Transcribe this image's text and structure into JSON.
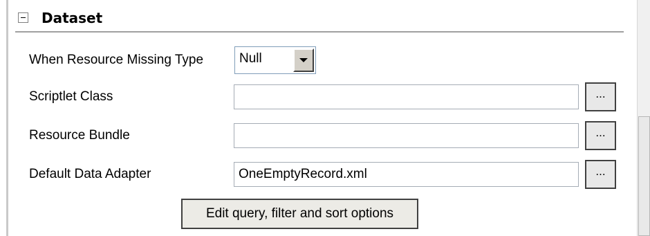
{
  "section": {
    "title": "Dataset",
    "toggle_icon": "minus-collapse-icon"
  },
  "rows": {
    "resource_missing": {
      "label": "When Resource Missing Type",
      "selected_value": "Null",
      "arrow_icon": "chevron-down-icon"
    },
    "scriptlet_class": {
      "label": "Scriptlet Class",
      "value": "",
      "browse_label": "..."
    },
    "resource_bundle": {
      "label": "Resource Bundle",
      "value": "",
      "browse_label": "..."
    },
    "default_data_adapter": {
      "label": "Default Data Adapter",
      "value": "OneEmptyRecord.xml",
      "browse_label": "..."
    }
  },
  "actions": {
    "edit_query_label": "Edit query, filter and sort options"
  }
}
